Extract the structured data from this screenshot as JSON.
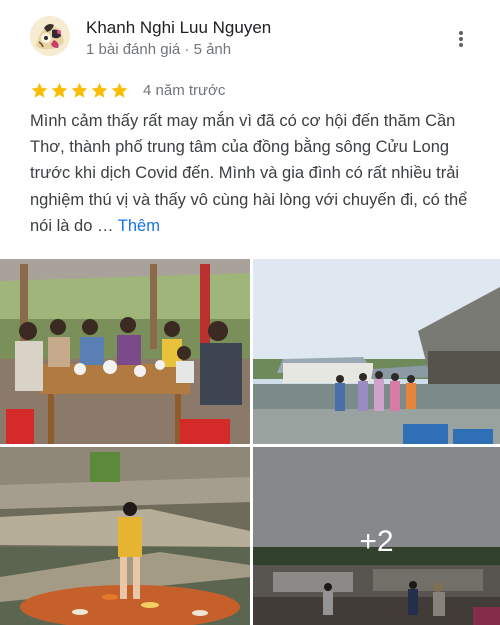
{
  "reviewer": {
    "name": "Khanh Nghi Luu Nguyen",
    "meta": "1 bài đánh giá · 5 ảnh"
  },
  "review": {
    "rating": 5,
    "max_rating": 5,
    "date": "4 năm trước",
    "text": "Mình cảm thấy rất may mắn vì đã có cơ hội đến thăm Cần Thơ, thành phố trung tâm của đồng bằng sông Cửu Long trước khi dịch Covid đến. Mình và gia đình có rất nhiều trải nghiệm thú vị và thấy vô cùng hài lòng với chuyến đi, có thể nói là do …",
    "more_label": "Thêm"
  },
  "photos": {
    "extra_count": "+2"
  },
  "colors": {
    "star": "#fbbc04",
    "link": "#1a73e8",
    "secondary_text": "#70757a",
    "primary_text": "#202124"
  },
  "icons": {
    "more": "more-vert-icon",
    "star": "star-icon"
  }
}
